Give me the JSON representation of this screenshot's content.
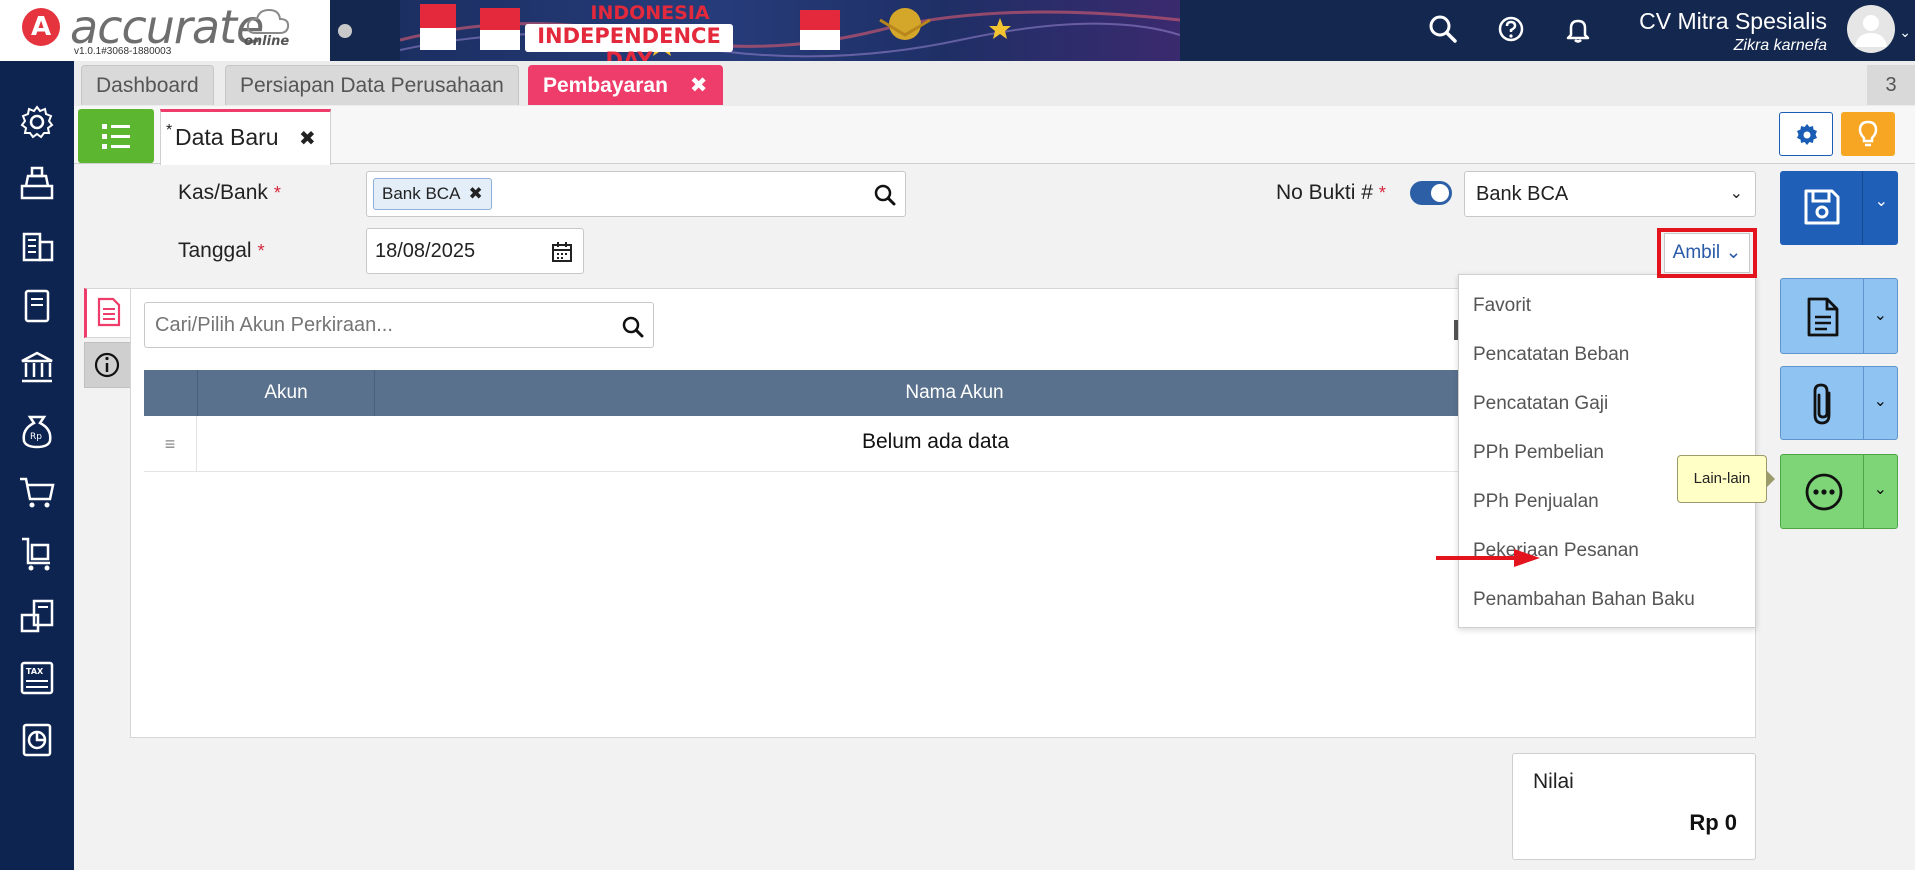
{
  "brand": {
    "logo_text": "accurate",
    "logo_sub": "online",
    "version": "v1.0.1#3068-1880003"
  },
  "banner": {
    "line1": "INDONESIA",
    "line2": "INDEPENDENCE DAY"
  },
  "header": {
    "company_name": "CV Mitra Spesialis",
    "user_name": "Zikra karnefa",
    "icons": [
      "search-icon",
      "help-icon",
      "bell-icon"
    ]
  },
  "sidebar": {
    "items": [
      "gear-icon",
      "cashier-icon",
      "building-icon",
      "book-icon",
      "bank-icon",
      "money-bag-icon",
      "cart-icon",
      "trolley-icon",
      "report-icon",
      "tax-icon",
      "chart-icon"
    ]
  },
  "tabs": [
    {
      "label": "Dashboard",
      "active": false
    },
    {
      "label": "Persiapan Data Perusahaan",
      "active": false
    },
    {
      "label": "Pembayaran",
      "active": true
    }
  ],
  "tab_counter": "3",
  "subtab": {
    "star": "*",
    "label": "Data Baru"
  },
  "form": {
    "kas_bank_label": "Kas/Bank",
    "kas_bank_value": "Bank BCA",
    "tanggal_label": "Tanggal",
    "tanggal_value": "18/08/2025",
    "no_bukti_label": "No Bukti #",
    "no_bukti_value": "Bank BCA",
    "required_mark": "*",
    "ambil_label": "Ambil"
  },
  "detail": {
    "search_placeholder": "Cari/Pilih Akun Perkiraan...",
    "columns": [
      "Akun",
      "Nama Akun"
    ],
    "empty_text": "Belum ada data"
  },
  "dropdown": {
    "items": [
      "Favorit",
      "Pencatatan Beban",
      "Pencatatan Gaji",
      "PPh Pembelian",
      "PPh Penjualan",
      "Pekerjaan Pesanan",
      "Penambahan Bahan Baku"
    ]
  },
  "tooltip": "Lain-lain",
  "summary": {
    "label": "Nilai",
    "value": "Rp 0"
  },
  "colors": {
    "accent_pink": "#ee3d6b",
    "sidebar_navy": "#0d2450",
    "primary_blue": "#1f5fb8",
    "annotation_red": "#e4141f"
  }
}
